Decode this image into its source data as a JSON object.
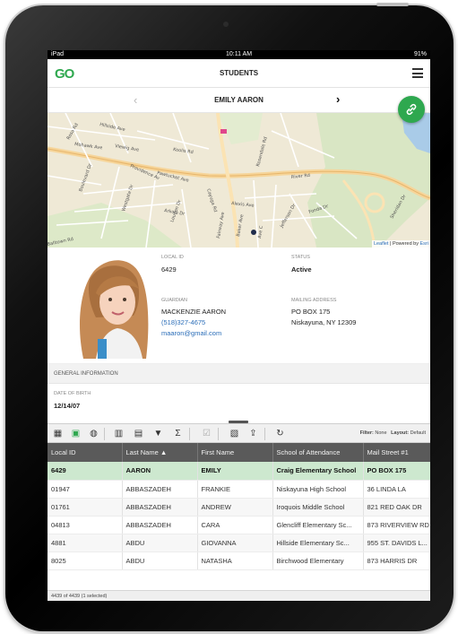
{
  "status_bar": {
    "device": "iPad",
    "time": "10:11 AM",
    "battery": "91%"
  },
  "app": {
    "logo": "GO",
    "title": "STUDENTS"
  },
  "record_nav": {
    "prev": "‹",
    "name": "EMILY AARON",
    "next": "›"
  },
  "map": {
    "attribution_leaflet": "Leaflet",
    "attribution_sep": " | Powered by ",
    "attribution_esri": "Esri",
    "streets": [
      "Hillside Ave",
      "Rosa Rd",
      "Viewig Ave",
      "Koolis Rd",
      "Mohawk Ave",
      "Providence Av",
      "Pawtucket Ave",
      "Cayuga Rd",
      "River Rd",
      "Boulevard Dr",
      "Westgate Dr",
      "Balltown Rd",
      "Alexis Ave",
      "Loudon Dr",
      "Arkola Dr",
      "Rosendale Rd",
      "Fairway Ave",
      "Baker Ave",
      "Ave C",
      "Jefferson Dr",
      "Fonda Dr",
      "Sheridan Dr"
    ]
  },
  "profile": {
    "local_id_label": "LOCAL ID",
    "local_id": "6429",
    "status_label": "STATUS",
    "status": "Active",
    "guardian_label": "GUARDIAN",
    "guardian_name": "MACKENZIE AARON",
    "guardian_phone": "(518)327-4675",
    "guardian_email": "maaron@gmail.com",
    "mailing_label": "MAILING ADDRESS",
    "mailing_line1": "PO BOX 175",
    "mailing_line2": "Niskayuna, NY 12309"
  },
  "general": {
    "header": "GENERAL INFORMATION",
    "dob_label": "DATE OF BIRTH",
    "dob": "12/14/07"
  },
  "toolbar": {
    "filter_label": "Filter:",
    "filter_value": "None",
    "layout_label": "Layout:",
    "layout_value": "Default"
  },
  "grid": {
    "columns": [
      "Local ID",
      "Last Name ▲",
      "First Name",
      "School of Attendance",
      "Mail Street #1"
    ],
    "rows": [
      [
        "6429",
        "AARON",
        "EMILY",
        "Craig Elementary School",
        "PO BOX 175"
      ],
      [
        "01947",
        "ABBASZADEH",
        "FRANKIE",
        "Niskayuna High School",
        "36 LINDA LA"
      ],
      [
        "01761",
        "ABBASZADEH",
        "ANDREW",
        "Iroquois Middle School",
        "821 RED OAK DR"
      ],
      [
        "04813",
        "ABBASZADEH",
        "CARA",
        "Glencliff Elementary Sc...",
        "873 RIVERVIEW RD"
      ],
      [
        "4881",
        "ABDU",
        "GIOVANNA",
        "Hillside Elementary Sc...",
        "955 ST. DAVIDS L..."
      ],
      [
        "8025",
        "ABDU",
        "NATASHA",
        "Birchwood Elementary",
        "873 HARRIS DR"
      ]
    ],
    "footer": "4439 of 4439 (1 selected)"
  }
}
